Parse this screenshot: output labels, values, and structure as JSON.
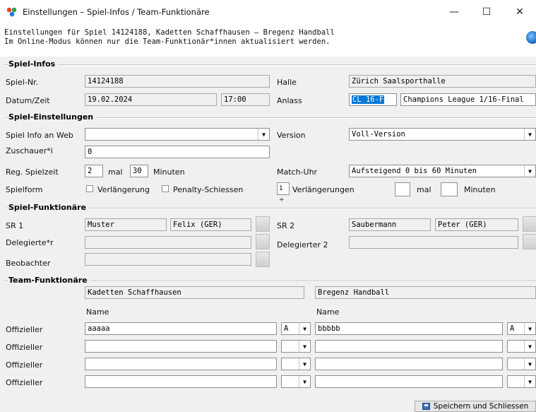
{
  "window": {
    "title": "Einstellungen – Spiel-Infos / Team-Funktionäre",
    "minimize": "—",
    "maximize": "☐",
    "close": "✕"
  },
  "header": {
    "line1": "Einstellungen für Spiel 14124188, Kadetten Schaffhausen – Bregenz Handball",
    "line2": "Im Online-Modus können nur die Team-Funktionär*innen aktualisiert werden."
  },
  "spiel_infos": {
    "section": "Spiel-Infos",
    "nr_label": "Spiel-Nr.",
    "nr_value": "14124188",
    "halle_label": "Halle",
    "halle_value": "Zürich Saalsporthalle",
    "datum_label": "Datum/Zeit",
    "datum_value": "19.02.2024",
    "zeit_value": "17:00",
    "anlass_label": "Anlass",
    "anlass_code": "CL 16-F",
    "anlass_value": "Champions League 1/16-Final"
  },
  "spiel_einstellungen": {
    "section": "Spiel-Einstellungen",
    "web_label": "Spiel Info an Web",
    "web_value": "",
    "version_label": "Version",
    "version_value": "Voll-Version",
    "zuschauer_label": "Zuschauer*i",
    "zuschauer_value": "0",
    "spielzeit_label": "Reg. Spielzeit",
    "spielzeit_count": "2",
    "mal": "mal",
    "spielzeit_minutes": "30",
    "minuten": "Minuten",
    "uhr_label": "Match-Uhr",
    "uhr_value": "Aufsteigend 0 bis 60 Minuten",
    "spielform_label": "Spielform",
    "verlaengerung_label": "Verlängerung",
    "penalty_label": "Penalty-Schiessen",
    "verl_count": "1",
    "verl_label": "Verlängerungen",
    "verl_mal": "mal",
    "verl_minuten": "Minuten"
  },
  "spiel_funktionaere": {
    "section": "Spiel-Funktionäre",
    "sr1_label": "SR 1",
    "sr1_last": "Muster",
    "sr1_first": "Felix (GER)",
    "sr2_label": "SR 2",
    "sr2_last": "Saubermann",
    "sr2_first": "Peter (GER)",
    "deleg1_label": "Delegierte*r",
    "deleg2_label": "Delegierter 2",
    "beob_label": "Beobachter"
  },
  "team_funktionaere": {
    "section": "Team-Funktionäre",
    "team_home": "Kadetten Schaffhausen",
    "team_away": "Bregenz Handball",
    "name_header": "Name",
    "rows": [
      {
        "label": "Offizieller",
        "home": "aaaaa",
        "home_role": "A",
        "away": "bbbbb",
        "away_role": "A"
      },
      {
        "label": "Offizieller",
        "home": "",
        "home_role": "",
        "away": "",
        "away_role": ""
      },
      {
        "label": "Offizieller",
        "home": "",
        "home_role": "",
        "away": "",
        "away_role": ""
      },
      {
        "label": "Offizieller",
        "home": "",
        "home_role": "",
        "away": "",
        "away_role": ""
      }
    ]
  },
  "footer": {
    "save_label": "Speichern und Schliessen"
  }
}
